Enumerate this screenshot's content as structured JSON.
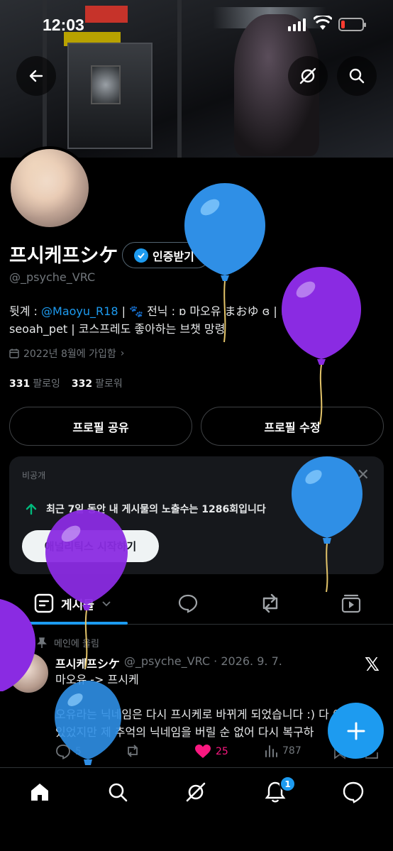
{
  "status_bar": {
    "time": "12:03"
  },
  "profile": {
    "name": "프시케프シケ",
    "verify_label": "인증받기",
    "handle": "@_psyche_VRC",
    "bio_prefix": "뒷계 : ",
    "bio_link": "@Maoyu_R18",
    "bio_rest": " | 🐾 전닉 : ɒ 마오유 まおゆ ɞ | Discord : seoah_pet | 코스프레도 좋아하는 브챗 망령",
    "joined": "2022년 8월에 가입함",
    "following_count": "331",
    "following_label": "팔로잉",
    "followers_count": "332",
    "followers_label": "팔로워"
  },
  "buttons": {
    "share_profile": "프로필 공유",
    "edit_profile": "프로필 수정"
  },
  "analytics_card": {
    "private_label": "비공개",
    "close": "✕",
    "stat_text": "최근 7일 동안 내 게시물의 노출수는 1286회입니다",
    "cta": "애널리틱스 시작하기"
  },
  "tabs": {
    "posts_label": "게시물"
  },
  "post": {
    "pinned_label": "메인에 올림",
    "author": "프시케프シケ",
    "meta": "@_psyche_VRC · 2026. 9. 7.",
    "line1": "마오유 -> 프시케",
    "line2": "오유라는 닉네임은 다시 프시케로 바뀌게 되었습니다 :) 다 이",
    "line3": "있었지만 제 추억의 닉네임을 버릴 순 없어 다시 복구하",
    "reply_count": "5",
    "like_count": "25",
    "view_count": "787"
  },
  "nav": {
    "notification_badge": "1"
  },
  "colors": {
    "accent": "#1d9bf0",
    "like": "#f91880",
    "balloon_blue": "#2f8fe6",
    "balloon_purple": "#8a2be2"
  }
}
